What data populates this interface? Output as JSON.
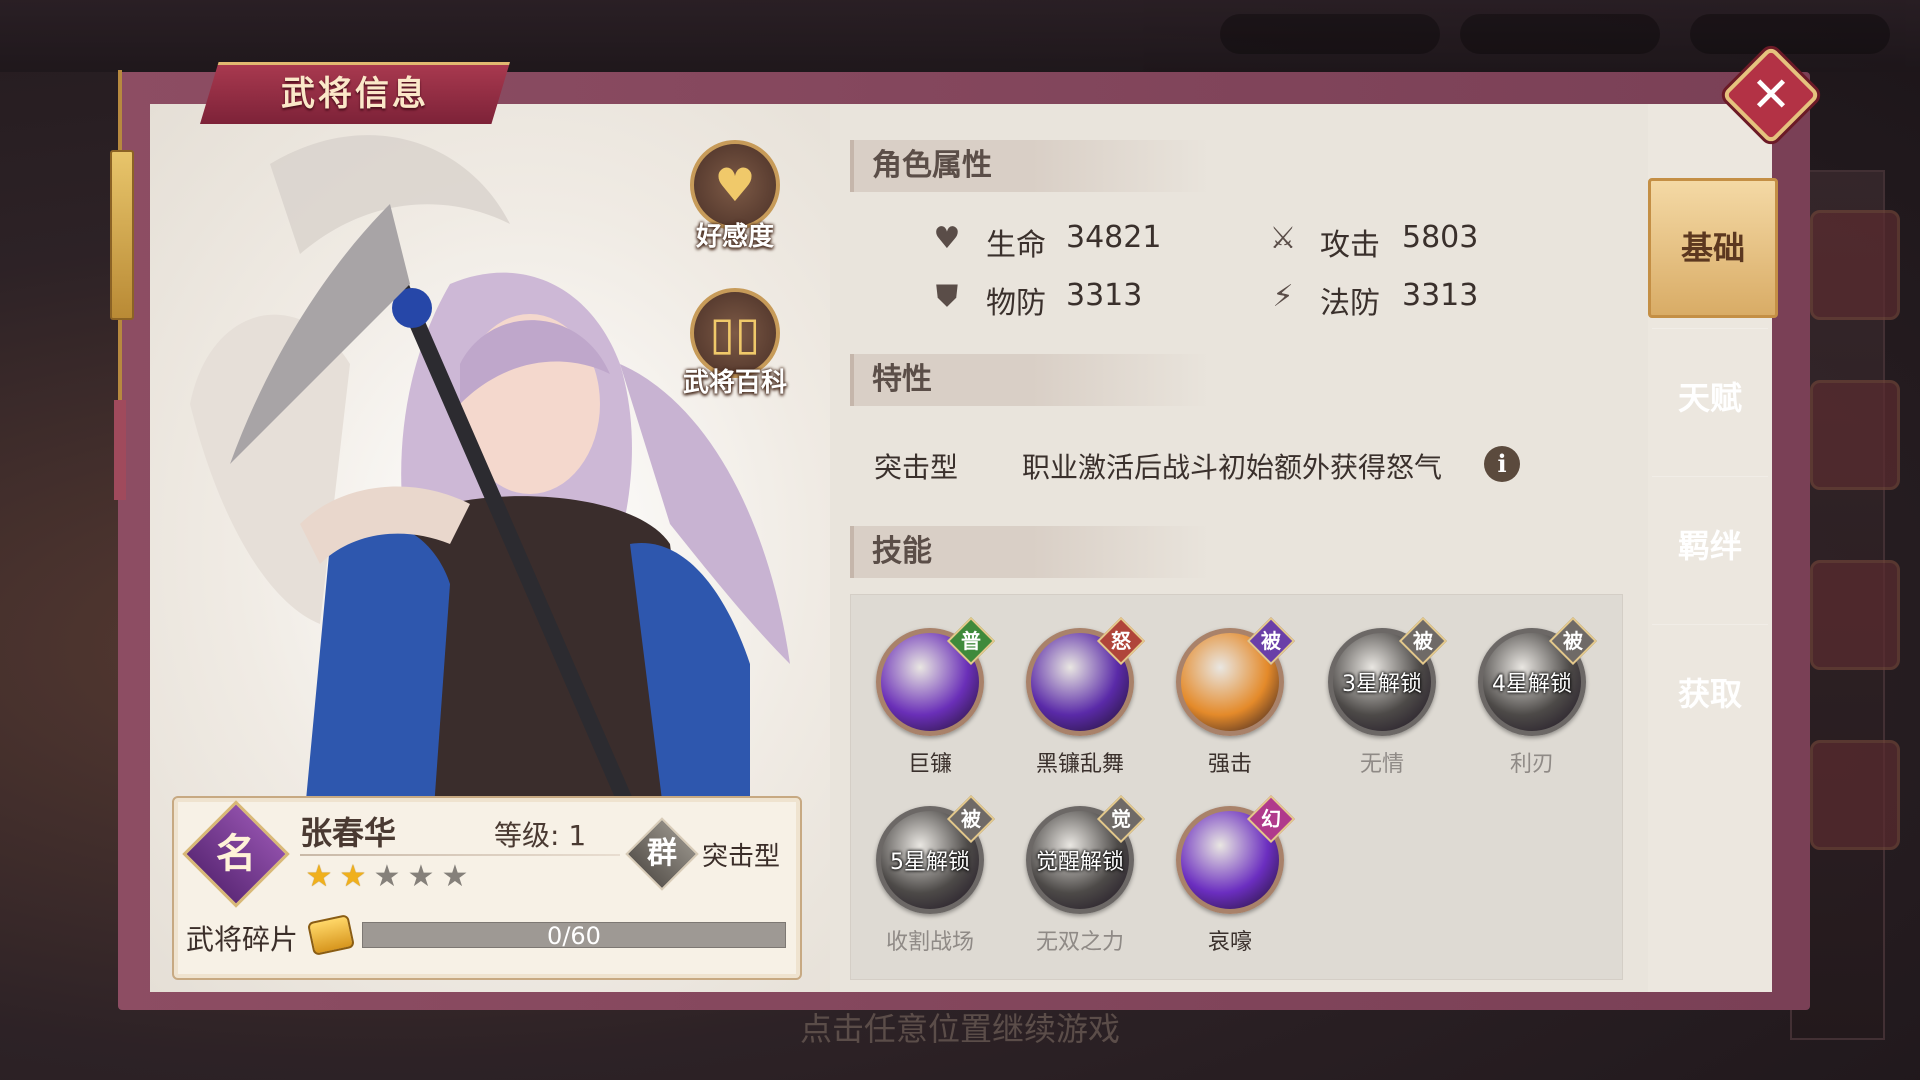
{
  "background": {
    "hint_text": "点击任意位置继续游戏"
  },
  "panel": {
    "title": "武将信息",
    "close_icon": "close-icon"
  },
  "portrait": {
    "buttons": [
      {
        "label": "好感度",
        "icon": "heart-icon"
      },
      {
        "label": "武将百科",
        "icon": "book-icon"
      }
    ]
  },
  "hero": {
    "badge": "名",
    "name": "张春华",
    "level_label": "等级: 1",
    "faction": "群",
    "class": "突击型",
    "stars_total": 5,
    "stars_filled": 2,
    "shard_label": "武将碎片",
    "shard_text": "0/60",
    "shard_progress": 0
  },
  "attributes": {
    "header": "角色属性",
    "stats": [
      {
        "icon": "heart-icon",
        "label": "生命",
        "value": "34821"
      },
      {
        "icon": "sword-icon",
        "label": "攻击",
        "value": "5803"
      },
      {
        "icon": "shield-icon",
        "label": "物防",
        "value": "3313"
      },
      {
        "icon": "magic-shield-icon",
        "label": "法防",
        "value": "3313"
      }
    ]
  },
  "traits": {
    "header": "特性",
    "name": "突击型",
    "description": "职业激活后战斗初始额外获得怒气",
    "info_icon": "info-icon"
  },
  "skills": {
    "header": "技能",
    "items": [
      {
        "name": "巨镰",
        "tag": "普",
        "tag_color": "#3f8a3b",
        "locked": false,
        "lock_text": "",
        "orb_color": "#6a2fb8"
      },
      {
        "name": "黑镰乱舞",
        "tag": "怒",
        "tag_color": "#b0453a",
        "locked": false,
        "lock_text": "",
        "orb_color": "#5a2aa8"
      },
      {
        "name": "强击",
        "tag": "被",
        "tag_color": "#6a3fa8",
        "locked": false,
        "lock_text": "",
        "orb_color": "#e48a2a"
      },
      {
        "name": "无情",
        "tag": "被",
        "tag_color": "#6f6a67",
        "locked": true,
        "lock_text": "3星解锁",
        "orb_color": "#4d4a48"
      },
      {
        "name": "利刃",
        "tag": "被",
        "tag_color": "#6f6a67",
        "locked": true,
        "lock_text": "4星解锁",
        "orb_color": "#4d4a48"
      },
      {
        "name": "收割战场",
        "tag": "被",
        "tag_color": "#6f6a67",
        "locked": true,
        "lock_text": "5星解锁",
        "orb_color": "#4d4a48"
      },
      {
        "name": "无双之力",
        "tag": "觉",
        "tag_color": "#6f6a67",
        "locked": true,
        "lock_text": "觉醒解锁",
        "orb_color": "#4d4a48"
      },
      {
        "name": "哀嚎",
        "tag": "幻",
        "tag_color": "#b03a8c",
        "locked": false,
        "lock_text": "",
        "orb_color": "#6b2ec0"
      }
    ]
  },
  "tabs": [
    {
      "label": "基础",
      "active": true
    },
    {
      "label": "天赋",
      "active": false
    },
    {
      "label": "羁绊",
      "active": false
    },
    {
      "label": "获取",
      "active": false
    }
  ]
}
